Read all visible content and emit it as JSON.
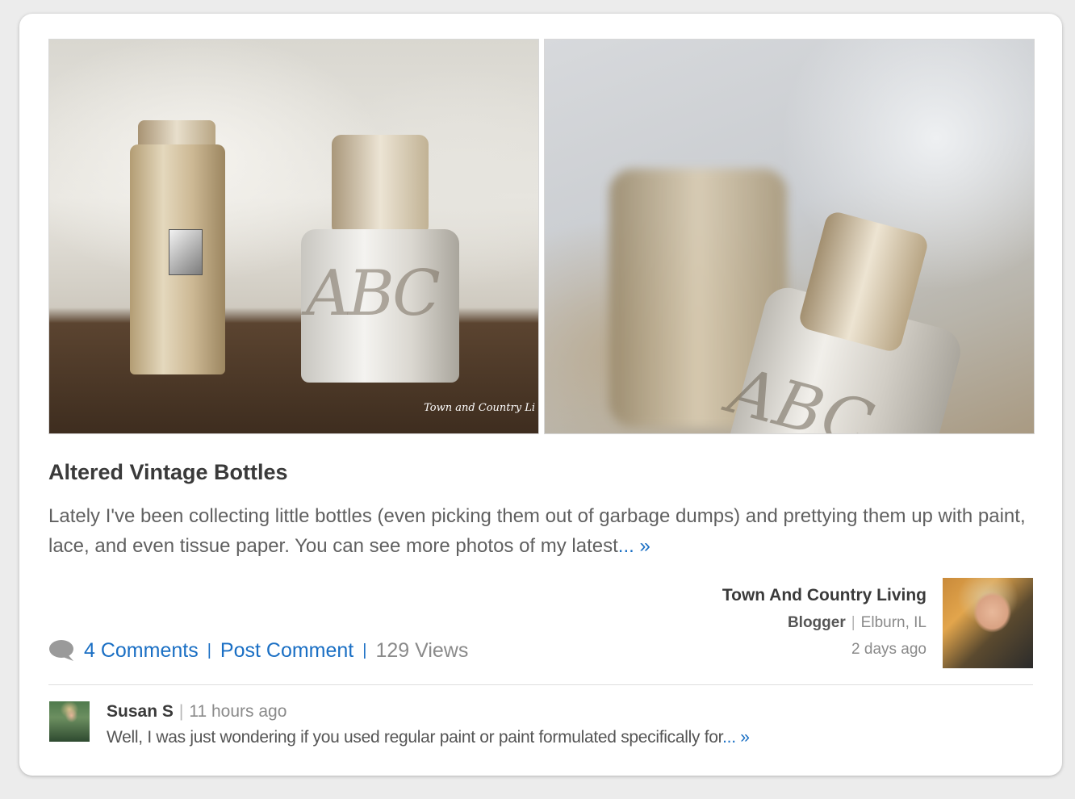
{
  "post": {
    "title": "Altered Vintage Bottles",
    "excerpt": "Lately I've been collecting little bottles (even picking them out of garbage dumps) and prettying them up with paint, lace, and even tissue paper. You can see more photos of my latest",
    "more_label": "... »",
    "photo1_watermark": "Town and Country Li",
    "photo1_letters": "ABC",
    "photo2_letters": "ABC"
  },
  "author": {
    "name": "Town And Country Living",
    "role": "Blogger",
    "separator": "|",
    "location": "Elburn, IL",
    "time": "2 days ago"
  },
  "stats": {
    "icon": "speech-bubble-icon",
    "comments_label": "4 Comments",
    "separator": "|",
    "post_comment_label": "Post Comment",
    "views_label": "129 Views"
  },
  "latest_comment": {
    "name": "Susan S",
    "separator": "|",
    "time": "11 hours ago",
    "text": "Well, I was just wondering if you used regular paint or paint formulated specifically for",
    "more_label": "... »"
  },
  "colors": {
    "link": "#1a6fc4",
    "title": "#3a3a3a",
    "body_text": "#606060",
    "meta_text": "#8a8a8a"
  }
}
